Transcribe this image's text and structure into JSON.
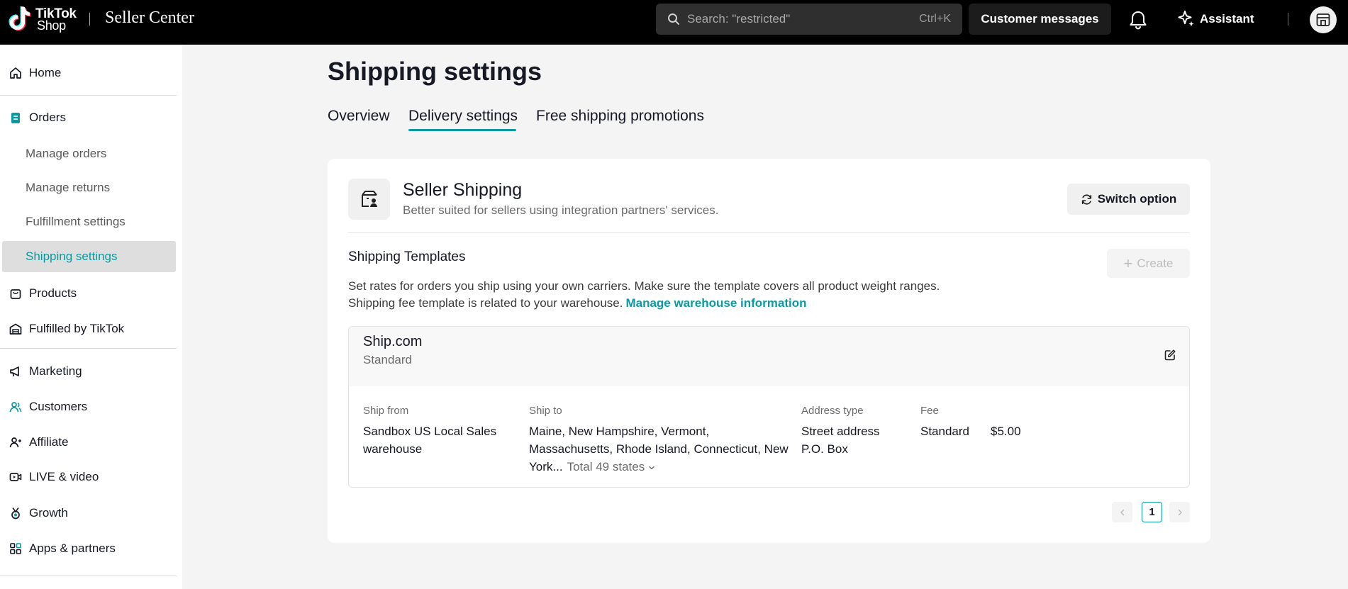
{
  "header": {
    "logo_tiktok": "TikTok",
    "logo_shop": "Shop",
    "app_title": "Seller Center",
    "search_placeholder": "Search: \"restricted\"",
    "search_shortcut": "Ctrl+K",
    "customer_messages": "Customer messages",
    "assistant": "Assistant"
  },
  "sidebar": {
    "home": "Home",
    "orders": "Orders",
    "orders_sub": [
      "Manage orders",
      "Manage returns",
      "Fulfillment settings",
      "Shipping settings"
    ],
    "products": "Products",
    "fulfilled": "Fulfilled by TikTok",
    "marketing": "Marketing",
    "customers": "Customers",
    "affiliate": "Affiliate",
    "live": "LIVE & video",
    "growth": "Growth",
    "apps": "Apps & partners"
  },
  "page": {
    "title": "Shipping settings",
    "tabs": [
      "Overview",
      "Delivery settings",
      "Free shipping promotions"
    ],
    "active_tab": "Delivery settings"
  },
  "seller_shipping": {
    "title": "Seller Shipping",
    "description": "Better suited for sellers using integration partners' services.",
    "switch_label": "Switch option"
  },
  "templates": {
    "title": "Shipping Templates",
    "create_label": "Create",
    "line1": "Set rates for orders you ship using your own carriers. Make sure the template covers all product weight ranges.",
    "line2": "Shipping fee template is related to your warehouse.",
    "link": "Manage warehouse information",
    "items": [
      {
        "name": "Ship.com",
        "type": "Standard",
        "labels": {
          "ship_from": "Ship from",
          "ship_to": "Ship to",
          "address_type": "Address type",
          "fee": "Fee"
        },
        "ship_from": "Sandbox US Local Sales warehouse",
        "ship_to": "Maine, New Hampshire, Vermont, Massachusetts, Rhode Island, Connecticut, New York...",
        "ship_to_total": "Total 49 states",
        "address_types": [
          "Street address",
          "P.O. Box"
        ],
        "fee_type": "Standard",
        "fee_amount": "$5.00"
      }
    ]
  },
  "pagination": {
    "current": "1"
  }
}
